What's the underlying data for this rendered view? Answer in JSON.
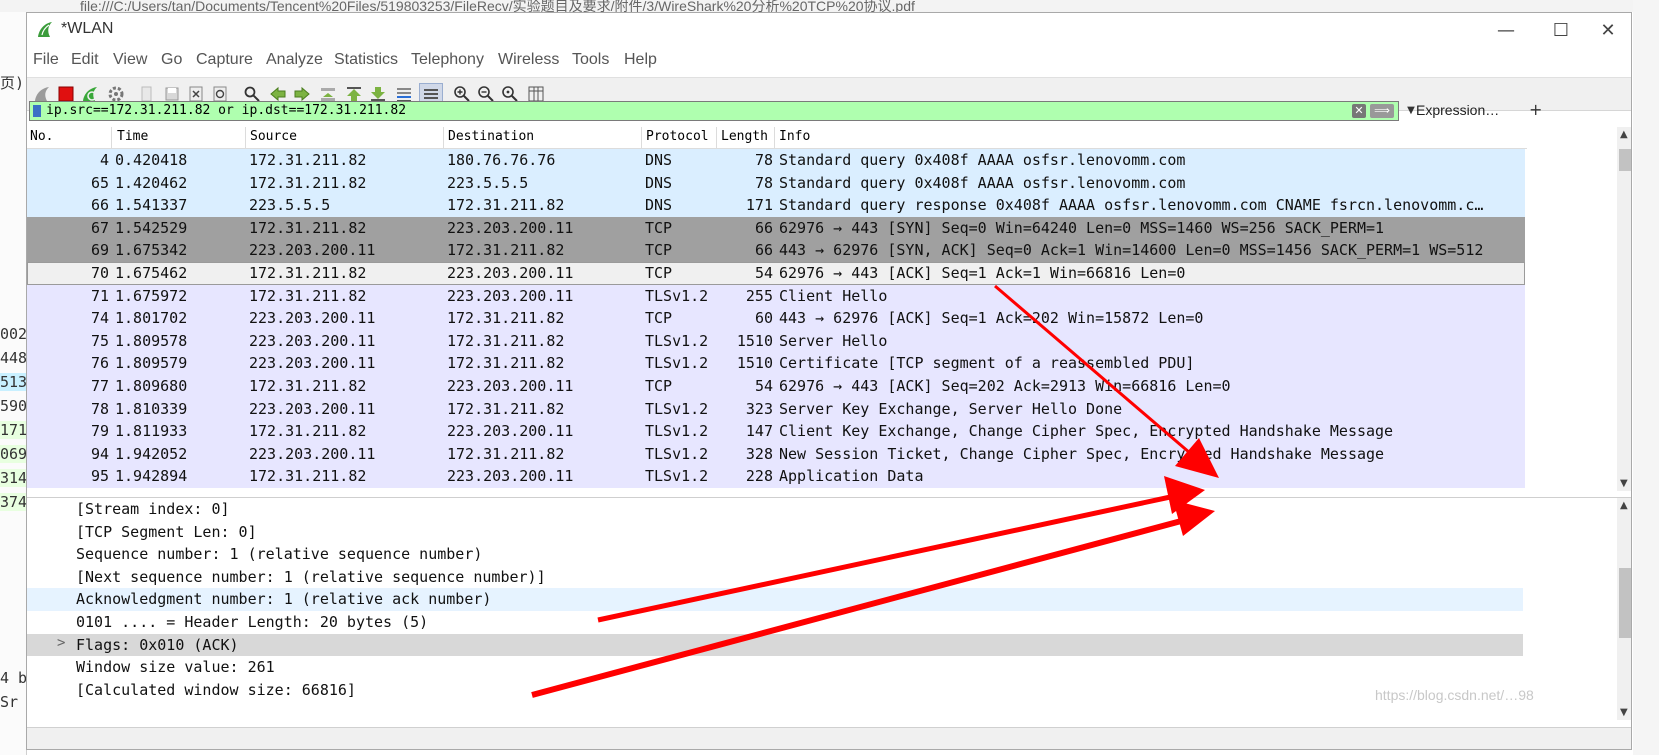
{
  "background": {
    "browser_url": "file:///C:/Users/tan/Documents/Tencent%20Files/519803253/FileRecv/实验题目及要求/附件/3/WireShark%20分析%20TCP%20协议.pdf",
    "left_fragments": [
      "页)",
      "002",
      "448",
      "513",
      "590",
      "171",
      "069",
      "314",
      "374",
      "4 b",
      "Sr"
    ]
  },
  "window": {
    "title": "*WLAN",
    "controls": {
      "minimize": "—",
      "maximize": "☐",
      "close": "✕"
    }
  },
  "menu": [
    "File",
    "Edit",
    "View",
    "Go",
    "Capture",
    "Analyze",
    "Statistics",
    "Telephony",
    "Wireless",
    "Tools",
    "Help"
  ],
  "filter": {
    "value": "ip.src==172.31.211.82 or ip.dst==172.31.211.82",
    "expression_label": "Expression…",
    "plus": "+"
  },
  "packet_list": {
    "columns": [
      "No.",
      "Time",
      "Source",
      "Destination",
      "Protocol",
      "Length",
      "Info"
    ],
    "rows": [
      {
        "no": "4",
        "time": "0.420418",
        "src": "172.31.211.82",
        "dst": "180.76.76.76",
        "proto": "DNS",
        "len": "78",
        "info": "Standard query 0x408f AAAA osfsr.lenovomm.com"
      },
      {
        "no": "65",
        "time": "1.420462",
        "src": "172.31.211.82",
        "dst": "223.5.5.5",
        "proto": "DNS",
        "len": "78",
        "info": "Standard query 0x408f AAAA osfsr.lenovomm.com"
      },
      {
        "no": "66",
        "time": "1.541337",
        "src": "223.5.5.5",
        "dst": "172.31.211.82",
        "proto": "DNS",
        "len": "171",
        "info": "Standard query response 0x408f AAAA osfsr.lenovomm.com CNAME fsrcn.lenovomm.c…"
      },
      {
        "no": "67",
        "time": "1.542529",
        "src": "172.31.211.82",
        "dst": "223.203.200.11",
        "proto": "TCP",
        "len": "66",
        "info": "62976 → 443 [SYN] Seq=0 Win=64240 Len=0 MSS=1460 WS=256 SACK_PERM=1"
      },
      {
        "no": "69",
        "time": "1.675342",
        "src": "223.203.200.11",
        "dst": "172.31.211.82",
        "proto": "TCP",
        "len": "66",
        "info": "443 → 62976 [SYN, ACK] Seq=0 Ack=1 Win=14600 Len=0 MSS=1456 SACK_PERM=1 WS=512"
      },
      {
        "no": "70",
        "time": "1.675462",
        "src": "172.31.211.82",
        "dst": "223.203.200.11",
        "proto": "TCP",
        "len": "54",
        "info": "62976 → 443 [ACK] Seq=1 Ack=1 Win=66816 Len=0"
      },
      {
        "no": "71",
        "time": "1.675972",
        "src": "172.31.211.82",
        "dst": "223.203.200.11",
        "proto": "TLSv1.2",
        "len": "255",
        "info": "Client Hello"
      },
      {
        "no": "74",
        "time": "1.801702",
        "src": "223.203.200.11",
        "dst": "172.31.211.82",
        "proto": "TCP",
        "len": "60",
        "info": "443 → 62976 [ACK] Seq=1 Ack=202 Win=15872 Len=0"
      },
      {
        "no": "75",
        "time": "1.809578",
        "src": "223.203.200.11",
        "dst": "172.31.211.82",
        "proto": "TLSv1.2",
        "len": "1510",
        "info": "Server Hello"
      },
      {
        "no": "76",
        "time": "1.809579",
        "src": "223.203.200.11",
        "dst": "172.31.211.82",
        "proto": "TLSv1.2",
        "len": "1510",
        "info": "Certificate [TCP segment of a reassembled PDU]"
      },
      {
        "no": "77",
        "time": "1.809680",
        "src": "172.31.211.82",
        "dst": "223.203.200.11",
        "proto": "TCP",
        "len": "54",
        "info": "62976 → 443 [ACK] Seq=202 Ack=2913 Win=66816 Len=0"
      },
      {
        "no": "78",
        "time": "1.810339",
        "src": "223.203.200.11",
        "dst": "172.31.211.82",
        "proto": "TLSv1.2",
        "len": "323",
        "info": "Server Key Exchange, Server Hello Done"
      },
      {
        "no": "79",
        "time": "1.811933",
        "src": "172.31.211.82",
        "dst": "223.203.200.11",
        "proto": "TLSv1.2",
        "len": "147",
        "info": "Client Key Exchange, Change Cipher Spec, Encrypted Handshake Message"
      },
      {
        "no": "94",
        "time": "1.942052",
        "src": "223.203.200.11",
        "dst": "172.31.211.82",
        "proto": "TLSv1.2",
        "len": "328",
        "info": "New Session Ticket, Change Cipher Spec, Encrypted Handshake Message"
      },
      {
        "no": "95",
        "time": "1.942894",
        "src": "172.31.211.82",
        "dst": "223.203.200.11",
        "proto": "TLSv1.2",
        "len": "228",
        "info": "Application Data"
      }
    ]
  },
  "details": {
    "lines": [
      "[Stream index: 0]",
      "[TCP Segment Len: 0]",
      "Sequence number: 1    (relative sequence number)",
      "[Next sequence number: 1    (relative sequence number)]",
      "Acknowledgment number: 1    (relative ack number)",
      "0101 .... = Header Length: 20 bytes (5)",
      "Flags: 0x010 (ACK)",
      "Window size value: 261",
      "[Calculated window size: 66816]"
    ],
    "expander": ">"
  },
  "watermark": "https://blog.csdn.net/…98",
  "colors": {
    "filter_valid": "#afffaf",
    "dns_row": "#daeeff",
    "syn_row": "#a0a0a0",
    "tls_row": "#e7e6ff",
    "selected_row": "#f0f0f0",
    "annotation_arrow": "#ff0000"
  }
}
